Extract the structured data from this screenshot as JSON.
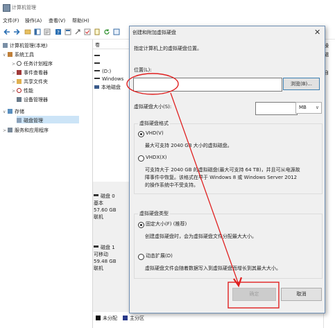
{
  "window": {
    "title": "计算机管理"
  },
  "menu": [
    "文件(F)",
    "操作(A)",
    "查看(V)",
    "帮助(H)"
  ],
  "tree": {
    "root": "计算机管理(本地)",
    "items": [
      {
        "label": "系统工具",
        "level": 1
      },
      {
        "label": "任务计划程序",
        "level": 2
      },
      {
        "label": "事件查看器",
        "level": 2
      },
      {
        "label": "共享文件夹",
        "level": 2
      },
      {
        "label": "性能",
        "level": 2
      },
      {
        "label": "设备管理器",
        "level": 2
      },
      {
        "label": "存储",
        "level": 1
      },
      {
        "label": "磁盘管理",
        "level": 2
      },
      {
        "label": "服务和应用程序",
        "level": 1
      }
    ]
  },
  "volumes": {
    "header": "卷",
    "rows": [
      "(D:)",
      "Windows",
      "本地磁盘"
    ]
  },
  "disks": [
    {
      "name": "磁盘 0",
      "type": "基本",
      "size": "57.60 GB",
      "status": "联机"
    },
    {
      "name": "磁盘 1",
      "type": "可移动",
      "size": "59.48 GB",
      "status": "联机"
    }
  ],
  "legend": {
    "unallocated": "未分配",
    "primary": "主分区"
  },
  "actions": {
    "a": "操",
    "b": "磁",
    "c": "自"
  },
  "dialog": {
    "title": "创建和附加虚拟硬盘",
    "instruction": "指定计算机上的虚拟硬盘位置。",
    "location_label": "位置(L):",
    "location_value": "",
    "browse": "浏览(B)...",
    "size_label": "虚拟硬盘大小(S):",
    "size_value": "",
    "unit": "MB",
    "format_group": "虚拟硬盘格式",
    "vhd_label": "VHD(V)",
    "vhd_desc": "最大可支持 2040 GB 大小的虚拟磁盘。",
    "vhdx_label": "VHDX(X)",
    "vhdx_desc_1": "可支持大于 2040 GB 的虚拟磁盘(最大可支持 64 TB)，并且可从电源故",
    "vhdx_desc_2": "障事件中恢复。该格式在早于 Windows 8 或 Windows Server 2012",
    "vhdx_desc_3": "的操作系统中不受支持。",
    "type_group": "虚拟硬盘类型",
    "fixed_label": "固定大小(F) (推荐)",
    "fixed_desc": "创建虚拟硬盘时，会为虚拟硬盘文件分配最大大小。",
    "dynamic_label": "动态扩展(D)",
    "dynamic_desc": "虚拟硬盘文件会随着数据写入到虚拟硬盘而增长到其最大大小。",
    "ok": "确定",
    "cancel": "取消"
  },
  "colors": {
    "annotation": "#e02020",
    "selection": "#cce4f7",
    "accent": "#3c7fb1"
  }
}
